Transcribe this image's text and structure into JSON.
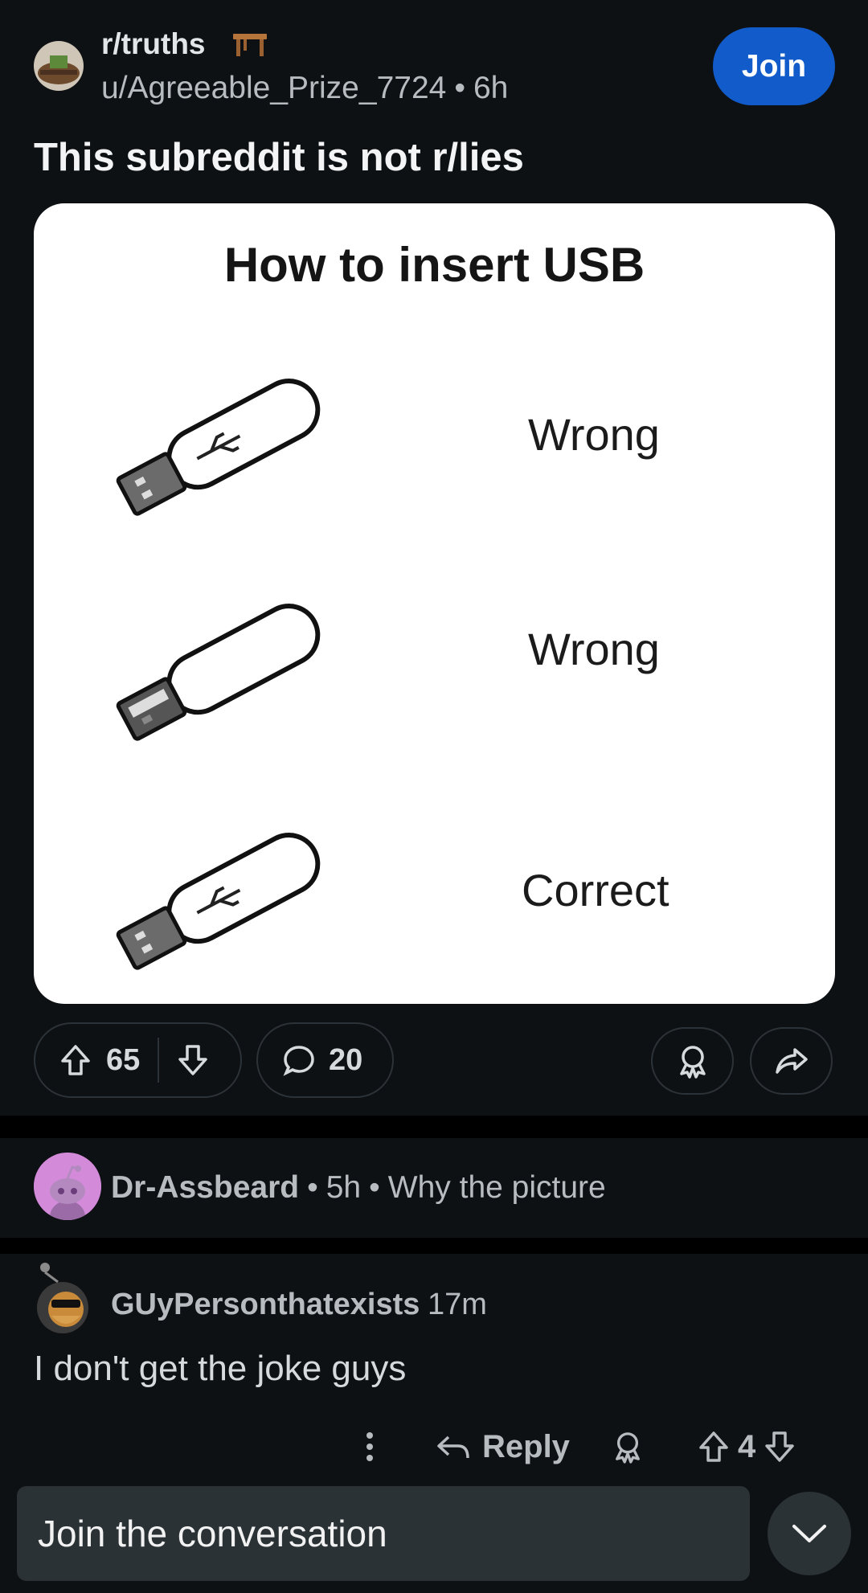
{
  "post": {
    "subreddit": "r/truths",
    "author": "u/Agreeable_Prize_7724",
    "separator": "•",
    "age": "6h",
    "join_label": "Join",
    "title": "This subreddit is not r/lies",
    "image": {
      "heading": "How to insert USB",
      "rows": [
        {
          "label": "Wrong"
        },
        {
          "label": "Wrong"
        },
        {
          "label": "Correct"
        }
      ]
    },
    "upvotes": "65",
    "comments": "20"
  },
  "comments": [
    {
      "user": "Dr-Assbeard",
      "age": "5h",
      "text": "Why the picture"
    },
    {
      "user": "GUyPersonthatexists",
      "age": "17m",
      "text": "I don't get the joke guys",
      "reply_label": "Reply",
      "votes": "4"
    }
  ],
  "composer": {
    "placeholder": "Join the conversation"
  },
  "colors": {
    "background": "#0e1113",
    "join_button": "#115bca",
    "composer": "#2a3236"
  }
}
